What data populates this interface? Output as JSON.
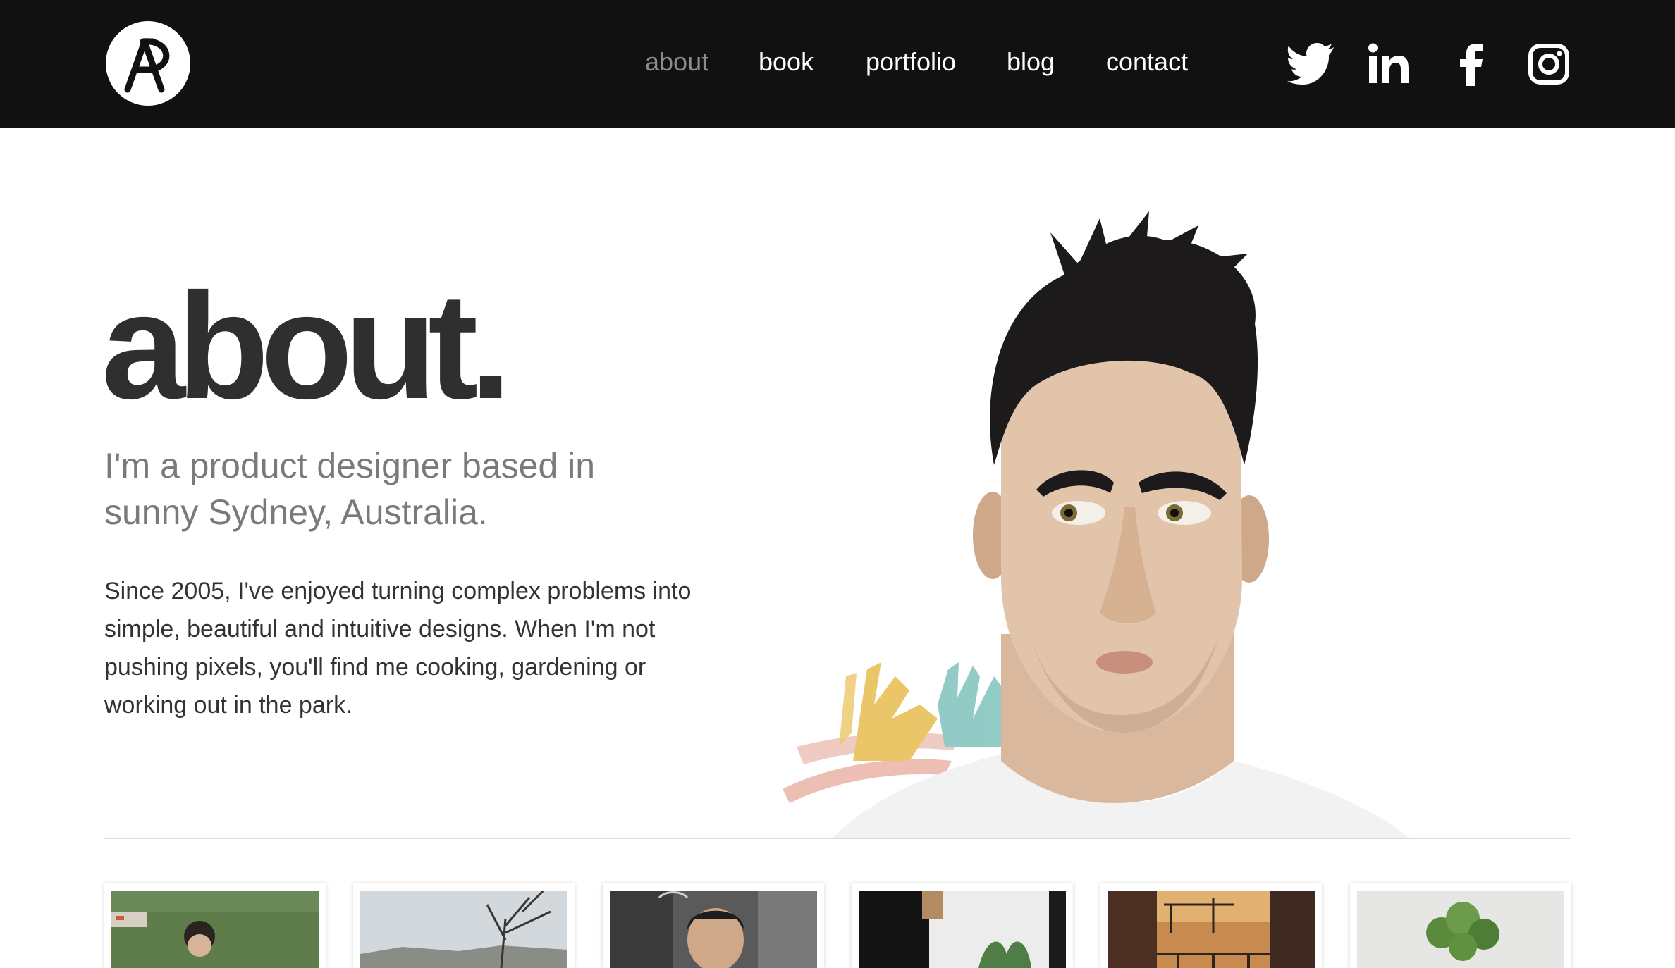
{
  "header": {
    "logo_icon": "ap-monogram-logo",
    "nav": [
      {
        "label": "about",
        "active": true
      },
      {
        "label": "book",
        "active": false
      },
      {
        "label": "portfolio",
        "active": false
      },
      {
        "label": "blog",
        "active": false
      },
      {
        "label": "contact",
        "active": false
      }
    ],
    "social_icons": [
      "twitter-icon",
      "linkedin-icon",
      "facebook-icon",
      "instagram-icon"
    ]
  },
  "hero": {
    "title": "about.",
    "subtitle": "I'm a product designer based in sunny Sydney, Australia.",
    "body": "Since 2005, I've enjoyed turning complex problems into simple, beautiful and intuitive designs. When I'm not pushing pixels, you'll find me cooking, gardening or working out in the park."
  },
  "gallery": {
    "thumbnails": [
      "childhood-photo",
      "tree-landscape-photo",
      "selfie-photo",
      "interior-plants-photo",
      "sunset-balcony-photo",
      "potted-plant-photo"
    ]
  },
  "colors": {
    "header_bg": "#111111",
    "nav_active": "#8c8c8c",
    "title": "#2f2f2f",
    "subtitle": "#7a7a7a",
    "body_text": "#333333",
    "paint_yellow": "#e8bd4e",
    "paint_teal": "#7fc3bd",
    "paint_pink": "#eab3a6"
  }
}
